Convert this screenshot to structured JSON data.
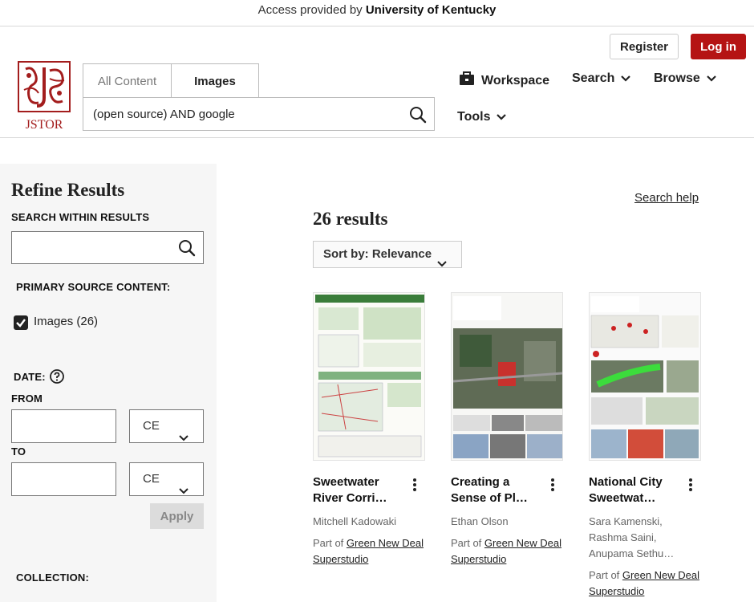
{
  "access_bar": {
    "prefix": "Access provided by ",
    "institution": "University of Kentucky"
  },
  "auth": {
    "register": "Register",
    "login": "Log in"
  },
  "logo": {
    "text": "JSTOR"
  },
  "search_tabs": {
    "all": "All Content",
    "images": "Images"
  },
  "main_search": {
    "value": "(open source) AND google"
  },
  "nav": {
    "workspace": "Workspace",
    "search": "Search",
    "browse": "Browse",
    "tools": "Tools"
  },
  "sidebar": {
    "title": "Refine Results",
    "search_within_label": "SEARCH WITHIN RESULTS",
    "primary_source_label": "PRIMARY SOURCE CONTENT:",
    "images_filter": "Images (26)",
    "date_label": "DATE:",
    "from_label": "FROM",
    "to_label": "TO",
    "era_from": "CE",
    "era_to": "CE",
    "apply": "Apply",
    "collection_label": "COLLECTION:"
  },
  "results": {
    "search_help": "Search help",
    "count": "26 results",
    "sort_label": "Sort by: Relevance",
    "items": [
      {
        "title": "Sweetwater River Corri…",
        "authors": "Mitchell Kadowaki",
        "part_of_prefix": "Part of ",
        "collection": "Green New Deal Superstudio"
      },
      {
        "title": "Creating a Sense of Pl…",
        "authors": "Ethan Olson",
        "part_of_prefix": "Part of ",
        "collection": "Green New Deal Superstudio"
      },
      {
        "title": "National City Sweetwat…",
        "authors": "Sara Kamenski, Rashma Saini, Anupama Sethu…",
        "part_of_prefix": "Part of ",
        "collection": "Green New Deal Superstudio"
      }
    ]
  },
  "colors": {
    "brand_red": "#b51414",
    "sidebar_bg": "#f6f6f6"
  }
}
